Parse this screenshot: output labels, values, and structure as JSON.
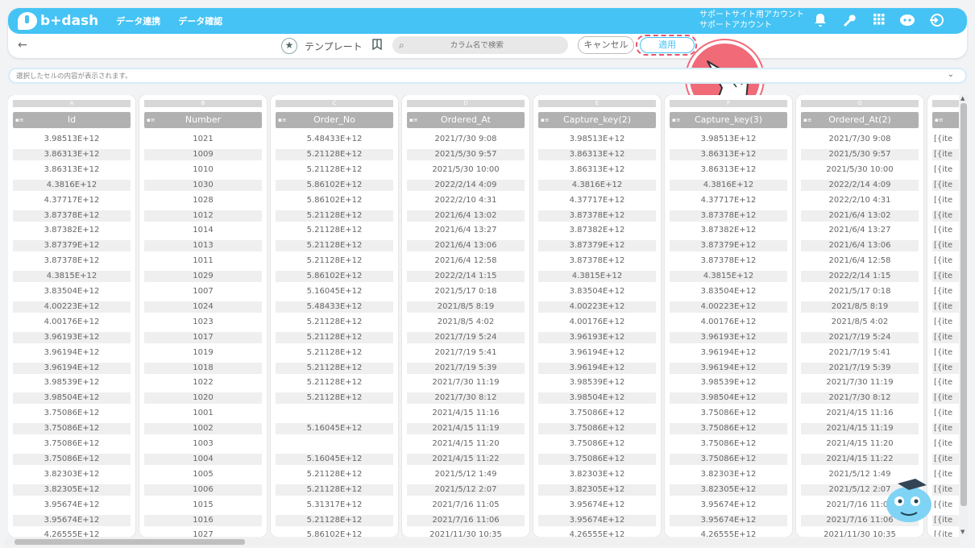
{
  "app": {
    "logo_text": "b+dash",
    "nav": [
      "データ連携",
      "データ確認"
    ],
    "account_line1": "サポートサイト用アカウント",
    "account_line2": "サポートアカウント",
    "icons": [
      "bell-icon",
      "wrench-icon",
      "apps-grid-icon",
      "chat-bot-icon",
      "logout-icon"
    ]
  },
  "toolbar": {
    "back_icon": "←",
    "template_label": "テンプレート",
    "search_placeholder": "カラム名で検索",
    "cancel_label": "キャンセル",
    "apply_label": "適用"
  },
  "cellbar": {
    "placeholder": "選択したセルの内容が表示されます。"
  },
  "columns": [
    {
      "letter": "A",
      "name": "Id",
      "cells": [
        "3.98513E+12",
        "3.86313E+12",
        "3.86313E+12",
        "4.3816E+12",
        "4.37717E+12",
        "3.87378E+12",
        "3.87382E+12",
        "3.87379E+12",
        "3.87378E+12",
        "4.3815E+12",
        "3.83504E+12",
        "4.00223E+12",
        "4.00176E+12",
        "3.96193E+12",
        "3.96194E+12",
        "3.96194E+12",
        "3.98539E+12",
        "3.98504E+12",
        "3.75086E+12",
        "3.75086E+12",
        "3.75086E+12",
        "3.75086E+12",
        "3.82303E+12",
        "3.82305E+12",
        "3.95674E+12",
        "3.95674E+12",
        "4.26555E+12"
      ]
    },
    {
      "letter": "B",
      "name": "Number",
      "cells": [
        "1021",
        "1009",
        "1010",
        "1030",
        "1028",
        "1012",
        "1014",
        "1013",
        "1011",
        "1029",
        "1007",
        "1024",
        "1023",
        "1017",
        "1019",
        "1018",
        "1022",
        "1020",
        "1001",
        "1002",
        "1003",
        "1004",
        "1005",
        "1006",
        "1015",
        "1016",
        "1027"
      ]
    },
    {
      "letter": "C",
      "name": "Order_No",
      "cells": [
        "5.48433E+12",
        "5.21128E+12",
        "5.21128E+12",
        "5.86102E+12",
        "5.86102E+12",
        "5.21128E+12",
        "5.21128E+12",
        "5.21128E+12",
        "5.21128E+12",
        "5.86102E+12",
        "5.16045E+12",
        "5.48433E+12",
        "5.21128E+12",
        "5.21128E+12",
        "5.21128E+12",
        "5.21128E+12",
        "5.21128E+12",
        "5.21128E+12",
        "",
        "5.16045E+12",
        "",
        "5.16045E+12",
        "5.21128E+12",
        "5.21128E+12",
        "5.31317E+12",
        "5.21128E+12",
        "5.86102E+12"
      ]
    },
    {
      "letter": "D",
      "name": "Ordered_At",
      "cells": [
        "2021/7/30 9:08",
        "2021/5/30 9:57",
        "2021/5/30 10:00",
        "2022/2/14 4:09",
        "2022/2/10 4:31",
        "2021/6/4 13:02",
        "2021/6/4 13:27",
        "2021/6/4 13:06",
        "2021/6/4 12:58",
        "2022/2/14 1:15",
        "2021/5/17 0:18",
        "2021/8/5 8:19",
        "2021/8/5 4:02",
        "2021/7/19 5:24",
        "2021/7/19 5:41",
        "2021/7/19 5:39",
        "2021/7/30 11:19",
        "2021/7/30 8:12",
        "2021/4/15 11:16",
        "2021/4/15 11:19",
        "2021/4/15 11:20",
        "2021/4/15 11:22",
        "2021/5/12 1:49",
        "2021/5/12 2:07",
        "2021/7/16 11:05",
        "2021/7/16 11:06",
        "2021/11/30 10:35"
      ]
    },
    {
      "letter": "E",
      "name": "Capture_key(2)",
      "cells": [
        "3.98513E+12",
        "3.86313E+12",
        "3.86313E+12",
        "4.3816E+12",
        "4.37717E+12",
        "3.87378E+12",
        "3.87382E+12",
        "3.87379E+12",
        "3.87378E+12",
        "4.3815E+12",
        "3.83504E+12",
        "4.00223E+12",
        "4.00176E+12",
        "3.96193E+12",
        "3.96194E+12",
        "3.96194E+12",
        "3.98539E+12",
        "3.98504E+12",
        "3.75086E+12",
        "3.75086E+12",
        "3.75086E+12",
        "3.75086E+12",
        "3.82303E+12",
        "3.82305E+12",
        "3.95674E+12",
        "3.95674E+12",
        "4.26555E+12"
      ]
    },
    {
      "letter": "F",
      "name": "Capture_key(3)",
      "cells": [
        "3.98513E+12",
        "3.86313E+12",
        "3.86313E+12",
        "4.3816E+12",
        "4.37717E+12",
        "3.87378E+12",
        "3.87382E+12",
        "3.87379E+12",
        "3.87378E+12",
        "4.3815E+12",
        "3.83504E+12",
        "4.00223E+12",
        "4.00176E+12",
        "3.96193E+12",
        "3.96194E+12",
        "3.96194E+12",
        "3.98539E+12",
        "3.98504E+12",
        "3.75086E+12",
        "3.75086E+12",
        "3.75086E+12",
        "3.75086E+12",
        "3.82303E+12",
        "3.82305E+12",
        "3.95674E+12",
        "3.95674E+12",
        "4.26555E+12"
      ]
    },
    {
      "letter": "G",
      "name": "Ordered_At(2)",
      "cells": [
        "2021/7/30 9:08",
        "2021/5/30 9:57",
        "2021/5/30 10:00",
        "2022/2/14 4:09",
        "2022/2/10 4:31",
        "2021/6/4 13:02",
        "2021/6/4 13:27",
        "2021/6/4 13:06",
        "2021/6/4 12:58",
        "2022/2/14 1:15",
        "2021/5/17 0:18",
        "2021/8/5 8:19",
        "2021/8/5 4:02",
        "2021/7/19 5:24",
        "2021/7/19 5:41",
        "2021/7/19 5:39",
        "2021/7/30 11:19",
        "2021/7/30 8:12",
        "2021/4/15 11:16",
        "2021/4/15 11:19",
        "2021/4/15 11:20",
        "2021/4/15 11:22",
        "2021/5/12 1:49",
        "2021/5/12 2:07",
        "2021/7/16 11:05",
        "2021/7/16 11:06",
        "2021/11/30 10:35"
      ]
    },
    {
      "letter": "",
      "name": "",
      "cells": [
        "[{ite",
        "[{ite",
        "[{ite",
        "[{ite",
        "[{ite",
        "[{ite",
        "[{ite",
        "[{ite",
        "[{ite",
        "[{ite",
        "[{ite",
        "[{ite",
        "[{ite",
        "[{ite",
        "[{ite",
        "[{ite",
        "[{ite",
        "[{ite",
        "[{ite",
        "[{ite",
        "[{ite",
        "[{ite",
        "[{ite",
        "[{ite",
        "[{ite",
        "[{ite",
        "[{ite"
      ]
    }
  ]
}
